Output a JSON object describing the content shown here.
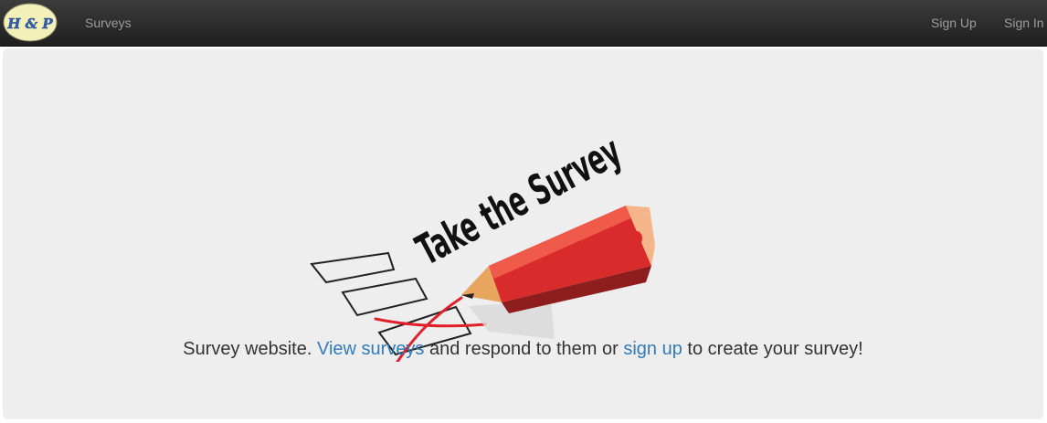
{
  "navbar": {
    "brand_text": "H & P",
    "items": [
      {
        "label": "Surveys"
      }
    ],
    "right_items": [
      {
        "label": "Sign Up"
      },
      {
        "label": "Sign In"
      }
    ]
  },
  "hero": {
    "image_text": "Take the Survey",
    "lead": {
      "before": "Survey website.",
      "link1": "View surveys",
      "middle": "and respond to them or",
      "link2": "sign up",
      "after": "to create your survey!"
    }
  },
  "colors": {
    "navbar_bg": "#222222",
    "nav_text": "#9d9d9d",
    "jumbotron_bg": "#eeeeee",
    "link": "#337ab7",
    "pencil_red": "#d92b2b",
    "mark_red": "#e0202a"
  }
}
